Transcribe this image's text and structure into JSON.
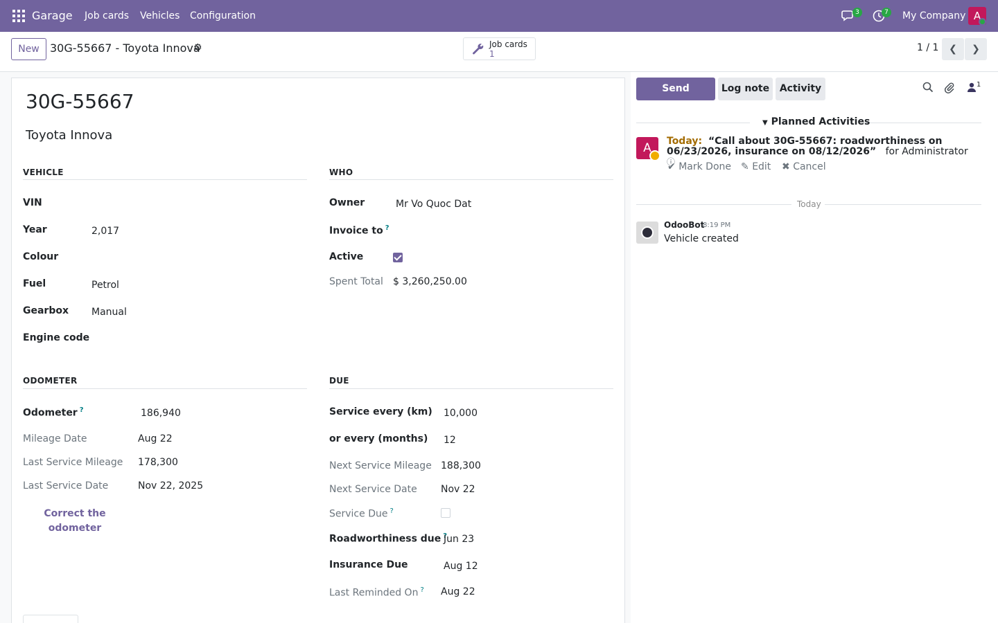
{
  "navbar": {
    "app_name": "Garage",
    "menu": [
      "Job cards",
      "Vehicles",
      "Configuration"
    ],
    "messages_badge": "3",
    "activities_badge": "7",
    "company": "My Company",
    "user_initial": "A"
  },
  "control_panel": {
    "new_label": "New",
    "breadcrumb": "30G-55667 - Toyota Innova",
    "smart_button": {
      "label": "Job cards",
      "count": "1"
    },
    "pager": "1 / 1"
  },
  "form": {
    "title": "30G-55667",
    "subtitle": "Toyota Innova",
    "vehicle": {
      "group_title": "VEHICLE",
      "vin_label": "VIN",
      "year_label": "Year",
      "year_value": "2,017",
      "colour_label": "Colour",
      "fuel_label": "Fuel",
      "fuel_value": "Petrol",
      "gearbox_label": "Gearbox",
      "gearbox_value": "Manual",
      "engine_label": "Engine code"
    },
    "who": {
      "group_title": "WHO",
      "owner_label": "Owner",
      "owner_value": "Mr Vo Quoc Dat",
      "invoice_label": "Invoice to",
      "active_label": "Active",
      "active_checked": true,
      "spent_label": "Spent Total",
      "spent_value": "$ 3,260,250.00"
    },
    "odometer": {
      "group_title": "ODOMETER",
      "odometer_label": "Odometer",
      "odometer_value": "186,940",
      "mileage_date_label": "Mileage Date",
      "mileage_date_value": "Aug 22",
      "last_service_mileage_label": "Last Service Mileage",
      "last_service_mileage_value": "178,300",
      "last_service_date_label": "Last Service Date",
      "last_service_date_value": "Nov 22, 2025",
      "correct_link": "Correct the odometer"
    },
    "due": {
      "group_title": "DUE",
      "service_km_label": "Service every (km)",
      "service_km_value": "10,000",
      "service_months_label": "or every (months)",
      "service_months_value": "12",
      "next_mileage_label": "Next Service Mileage",
      "next_mileage_value": "188,300",
      "next_date_label": "Next Service Date",
      "next_date_value": "Nov 22",
      "service_due_label": "Service Due",
      "service_due_checked": false,
      "roadworthiness_label": "Roadworthiness due",
      "roadworthiness_value": "Jun 23",
      "insurance_label": "Insurance Due",
      "insurance_value": "Aug 12",
      "last_reminded_label": "Last Reminded On",
      "last_reminded_value": "Aug 22"
    },
    "help_mark": "?"
  },
  "chatter": {
    "send_message": "Send message",
    "log_note": "Log note",
    "activity": "Activity",
    "followers_count": "1",
    "planned_title": "Planned Activities",
    "activity_item": {
      "avatar_initial": "A",
      "when": "Today:",
      "summary": "“Call about 30G-55667: roadworthiness on 06/23/2026, insurance on 08/12/2026”",
      "assignee": "for Administrator",
      "mark_done": "Mark Done",
      "edit": "Edit",
      "cancel": "Cancel"
    },
    "date_separator": "Today",
    "message": {
      "author": "OdooBot",
      "time": "8:19 PM",
      "body": "Vehicle created"
    }
  }
}
